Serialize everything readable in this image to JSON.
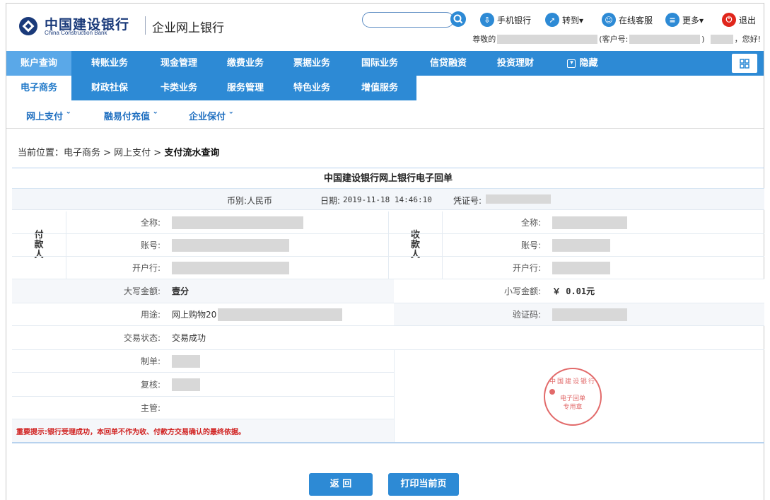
{
  "header": {
    "brand_cn": "中国建设银行",
    "brand_en": "China Construction Bank",
    "brand_sub": "企业网上银行",
    "links": {
      "mobile": "手机银行",
      "goto": "转到▾",
      "service": "在线客服",
      "more": "更多▾",
      "logout": "退出"
    },
    "greet_prefix": "尊敬的",
    "customer_no": "(客户号:",
    "customer_close": ")",
    "hello": "，您好!"
  },
  "nav": {
    "row1": [
      "账户查询",
      "转账业务",
      "现金管理",
      "缴费业务",
      "票据业务",
      "国际业务",
      "信贷融资",
      "投资理财",
      "隐藏"
    ],
    "row2": [
      "电子商务",
      "财政社保",
      "卡类业务",
      "服务管理",
      "特色业务",
      "增值服务"
    ],
    "sub": [
      "网上支付 ˇ",
      "融易付充值 ˇ",
      "企业保付 ˇ"
    ]
  },
  "breadcrumb": {
    "prefix": "当前位置：电子商务 > 网上支付 > ",
    "current": "支付流水查询"
  },
  "receipt": {
    "title": "中国建设银行网上银行电子回单",
    "currency": "币别:人民币",
    "date_label": "日期:",
    "date": "2019-11-18 14:46:10",
    "voucher": "凭证号:",
    "payer_side": "付\n款\n人",
    "payee_side": "收\n款\n人",
    "labels": {
      "name": "全称:",
      "account": "账号:",
      "bank": "开户行:",
      "amount_upper": "大写金额:",
      "amount_lower": "小写金额:",
      "purpose": "用途:",
      "verify": "验证码:",
      "status": "交易状态:",
      "maker": "制单:",
      "checker": "复核:",
      "supervisor": "主管:"
    },
    "amount_upper": "壹分",
    "amount_lower": "￥ 0.01元",
    "purpose": "网上购物20",
    "status": "交易成功",
    "warning": "重要提示:银行受理成功，本回单不作为收、付款方交易确认的最终依据。",
    "stamp_top": "中国建设银行",
    "stamp_mid": "电子回单",
    "stamp_bottom": "专用章"
  },
  "buttons": {
    "back": "返 回",
    "print": "打印当前页"
  },
  "colors": {
    "primary": "#2d8ad5",
    "brand": "#1a3a7a",
    "warn": "#d0201f",
    "stamp": "#e26a6a"
  }
}
